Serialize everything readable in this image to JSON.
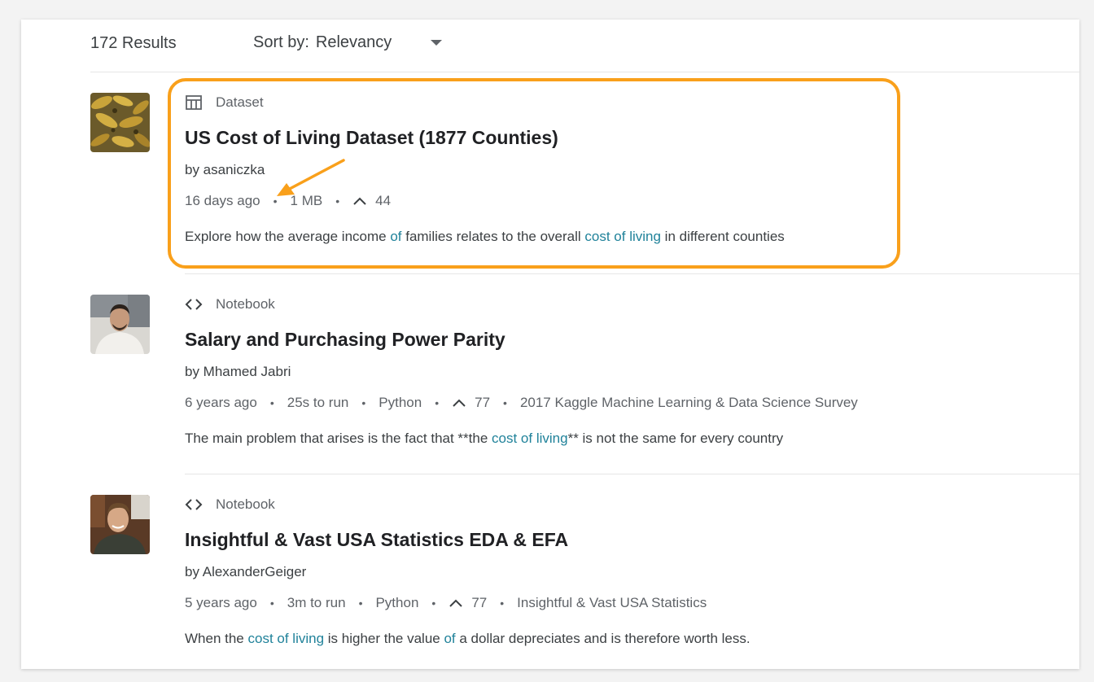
{
  "header": {
    "results_count": "172 Results",
    "sort_label": "Sort by:",
    "sort_value": "Relevancy"
  },
  "results": [
    {
      "type": "Dataset",
      "type_icon": "table-icon",
      "title": "US Cost of Living Dataset (1877 Counties)",
      "author": "by asaniczka",
      "meta": [
        "16 days ago",
        "1 MB"
      ],
      "upvotes": "44",
      "description_parts": [
        {
          "text": "Explore how the average income ",
          "hl": false
        },
        {
          "text": "of",
          "hl": true
        },
        {
          "text": " families relates to the overall ",
          "hl": false
        },
        {
          "text": "cost of living",
          "hl": true
        },
        {
          "text": " in different counties",
          "hl": false
        }
      ],
      "thumbnail": "bananas-image"
    },
    {
      "type": "Notebook",
      "type_icon": "code-icon",
      "title": "Salary and Purchasing Power Parity",
      "author": "by Mhamed Jabri",
      "meta": [
        "6 years ago",
        "25s to run",
        "Python"
      ],
      "upvotes": "77",
      "meta_after": "2017 Kaggle Machine Learning & Data Science Survey",
      "description_parts": [
        {
          "text": "The main problem that arises is the fact that **the ",
          "hl": false
        },
        {
          "text": "cost of living",
          "hl": true
        },
        {
          "text": "** is not the same for every country",
          "hl": false
        }
      ],
      "thumbnail": "avatar-photo"
    },
    {
      "type": "Notebook",
      "type_icon": "code-icon",
      "title": "Insightful & Vast USA Statistics EDA & EFA",
      "author": "by AlexanderGeiger",
      "meta": [
        "5 years ago",
        "3m to run",
        "Python"
      ],
      "upvotes": "77",
      "meta_after": "Insightful & Vast USA Statistics",
      "description_parts": [
        {
          "text": "When the ",
          "hl": false
        },
        {
          "text": "cost of living",
          "hl": true
        },
        {
          "text": " is higher the value ",
          "hl": false
        },
        {
          "text": "of",
          "hl": true
        },
        {
          "text": " a dollar depreciates and is therefore worth less.",
          "hl": false
        }
      ],
      "thumbnail": "avatar-photo"
    }
  ],
  "annotation": {
    "highlight_color": "#f9a01b"
  }
}
